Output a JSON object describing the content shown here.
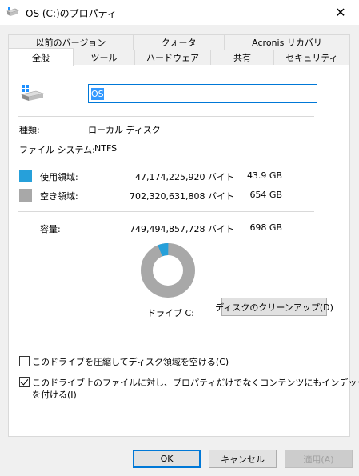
{
  "window": {
    "title": "OS (C:)のプロパティ",
    "close_glyph": "✕"
  },
  "tabs": {
    "row_back": [
      {
        "label": "以前のバージョン"
      },
      {
        "label": "クォータ"
      },
      {
        "label": "Acronis リカバリ"
      }
    ],
    "row_front": [
      {
        "label": "全般",
        "active": true
      },
      {
        "label": "ツール"
      },
      {
        "label": "ハードウェア"
      },
      {
        "label": "共有"
      },
      {
        "label": "セキュリティ"
      }
    ]
  },
  "general": {
    "drive_name": "OS",
    "type_label": "種類:",
    "type_value": "ローカル ディスク",
    "fs_label": "ファイル システム:",
    "fs_value": "NTFS",
    "used_label": "使用領域:",
    "used_bytes": "47,174,225,920 バイト",
    "used_size": "43.9 GB",
    "used_color": "#26a0da",
    "free_label": "空き領域:",
    "free_bytes": "702,320,631,808 バイト",
    "free_size": "654 GB",
    "free_color": "#a8a8a8",
    "capacity_label": "容量:",
    "capacity_bytes": "749,494,857,728 バイト",
    "capacity_size": "698 GB",
    "used_fraction": 0.063,
    "drive_label": "ドライブ C:",
    "cleanup_label": "ディスクのクリーンアップ(D)",
    "compress_label": "このドライブを圧縮してディスク領域を空ける(C)",
    "compress_checked": false,
    "index_label_line1": "このドライブ上のファイルに対し、プロパティだけでなくコンテンツにもインデックス",
    "index_label_line2": "を付ける(I)",
    "index_checked": true
  },
  "buttons": {
    "ok": "OK",
    "cancel": "キャンセル",
    "apply": "適用(A)"
  }
}
